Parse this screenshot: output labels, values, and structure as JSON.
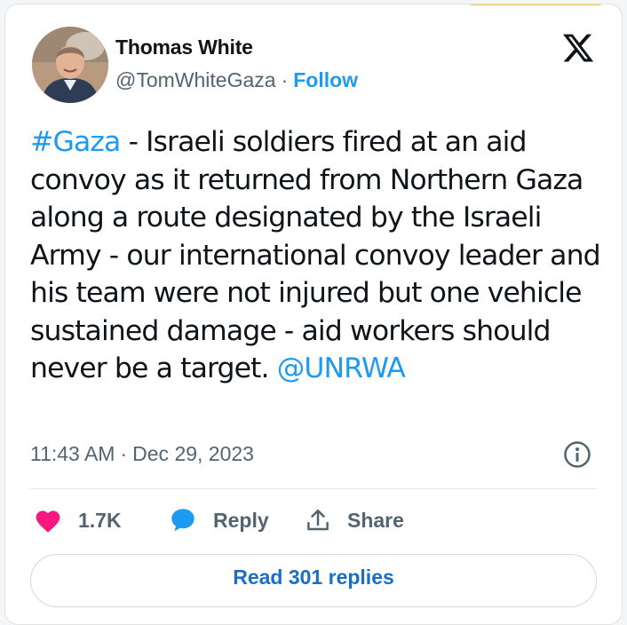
{
  "author": {
    "name": "Thomas White",
    "handle": "@TomWhiteGaza",
    "separator": "·",
    "follow_label": "Follow"
  },
  "tweet": {
    "hashtag": "#Gaza",
    "text": " - Israeli soldiers fired at an aid convoy as it returned from Northern Gaza along a route designated by the Israeli Army - our international convoy leader and his team were not injured but one vehicle sustained damage - aid workers should never be a target. ",
    "mention": "@UNRWA"
  },
  "meta": {
    "time": "11:43 AM",
    "separator": "·",
    "date": "Dec 29, 2023"
  },
  "actions": {
    "like_count": "1.7K",
    "reply_label": "Reply",
    "share_label": "Share",
    "read_replies_label": "Read 301 replies"
  },
  "icons": {
    "brand": "x-logo-icon",
    "info": "info-icon",
    "like": "heart-icon",
    "reply": "speech-bubble-icon",
    "share": "share-icon"
  },
  "colors": {
    "link": "#1d9bf0",
    "heart": "#f91880",
    "reply_bubble": "#1d9bf0",
    "text": "#0f1419",
    "muted": "#536471"
  }
}
